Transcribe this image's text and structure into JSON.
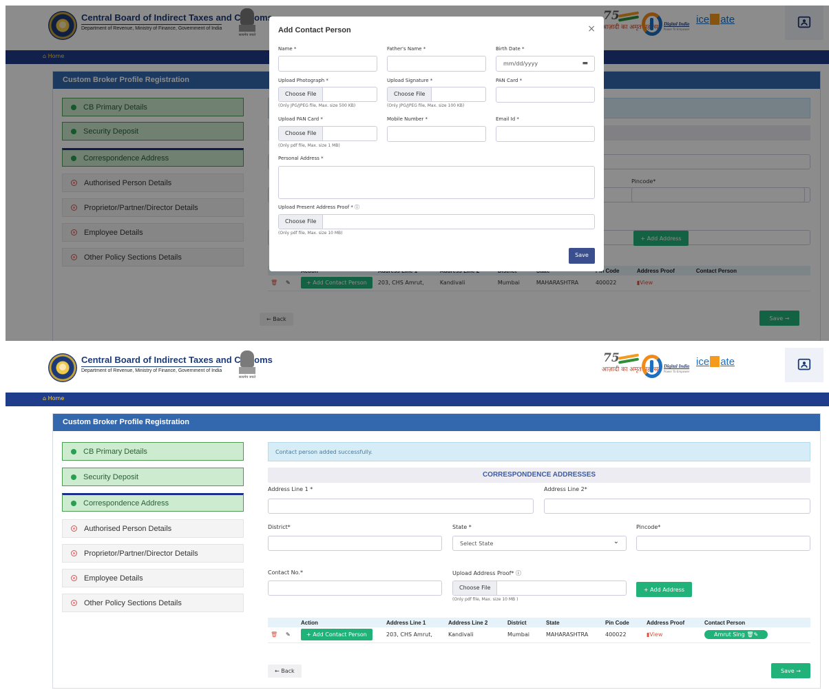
{
  "header": {
    "title": "Central Board of Indirect Taxes and Customs",
    "subtitle": "Department of Revenue, Ministry of Finance, Government of India",
    "emblem_caption": "सत्यमेव जयते",
    "azadi_text": "आज़ादी का अमृत महोत्सव",
    "digital_india": "Digital India",
    "digital_india_tag": "Power To Empower",
    "icegate": "icegate",
    "feedback_icon": "feedback-icon"
  },
  "nav": {
    "home": "⌂ Home"
  },
  "card_title": "Custom Broker Profile Registration",
  "sidebar": [
    {
      "label": "CB Primary Details",
      "status": "done"
    },
    {
      "label": "Security Deposit",
      "status": "done"
    },
    {
      "label": "Correspondence Address",
      "status": "done"
    },
    {
      "label": "Authorised Person Details",
      "status": "todo"
    },
    {
      "label": "Proprietor/Partner/Director Details",
      "status": "todo"
    },
    {
      "label": "Employee Details",
      "status": "todo"
    },
    {
      "label": "Other Policy Sections Details",
      "status": "todo"
    }
  ],
  "alert": "Contact person added successfully.",
  "section_title": "CORRESPONDENCE ADDRESSES",
  "form": {
    "address_line1": "Address Line 1 *",
    "address_line2": "Address Line 2*",
    "district": "District*",
    "state": "State *",
    "state_value": "Select State",
    "pincode": "Pincode*",
    "contact": "Contact No.*",
    "upload_proof": "Upload Address Proof* ⓘ",
    "choose_file": "Choose File",
    "proof_hint": "(Only pdf file, Max. size 10 MB )",
    "add_address": "+ Add Address"
  },
  "table": {
    "headers": [
      "",
      "",
      "Action",
      "Address Line 1",
      "Address Line 2",
      "District",
      "State",
      "Pin Code",
      "Address Proof",
      "Contact Person"
    ],
    "row": {
      "add_contact": "+ Add Contact Person",
      "address1": "203, CHS Amrut,",
      "address2": "Kandivali",
      "district": "Mumbai",
      "state": "MAHARASHTRA",
      "pincode": "400022",
      "proof": "View",
      "contact_person": "Amrut Sing"
    }
  },
  "buttons": {
    "back": "←  Back",
    "save": "Save  →"
  },
  "modal": {
    "title": "Add Contact Person",
    "close": "×",
    "name": "Name *",
    "father": "Father's Name *",
    "birth": "Birth Date *",
    "birth_placeholder": "mm/dd/yyyy",
    "photo": "Upload Photograph *",
    "photo_hint": "(Only JPG/JPEG file, Max. size 500 KB)",
    "signature": "Upload Signature *",
    "signature_hint": "(Only JPG/JPEG file, Max. size 100 KB)",
    "pan": "PAN Card *",
    "upload_pan": "Upload PAN Card *",
    "pan_hint": "(Only pdf file, Max. size 1 MB)",
    "mobile": "Mobile Number *",
    "email": "Email Id *",
    "personal_address": "Personal Address *",
    "present_proof": "Upload Present Address Proof * ⓘ",
    "present_hint": "(Only pdf file, Max. size 10 MB)",
    "choose_file": "Choose File",
    "save": "Save"
  },
  "colors": {
    "nav": "#1f3d8a",
    "card_header": "#3368ae",
    "success": "#21b27a",
    "done_bg": "#cdeccf"
  }
}
